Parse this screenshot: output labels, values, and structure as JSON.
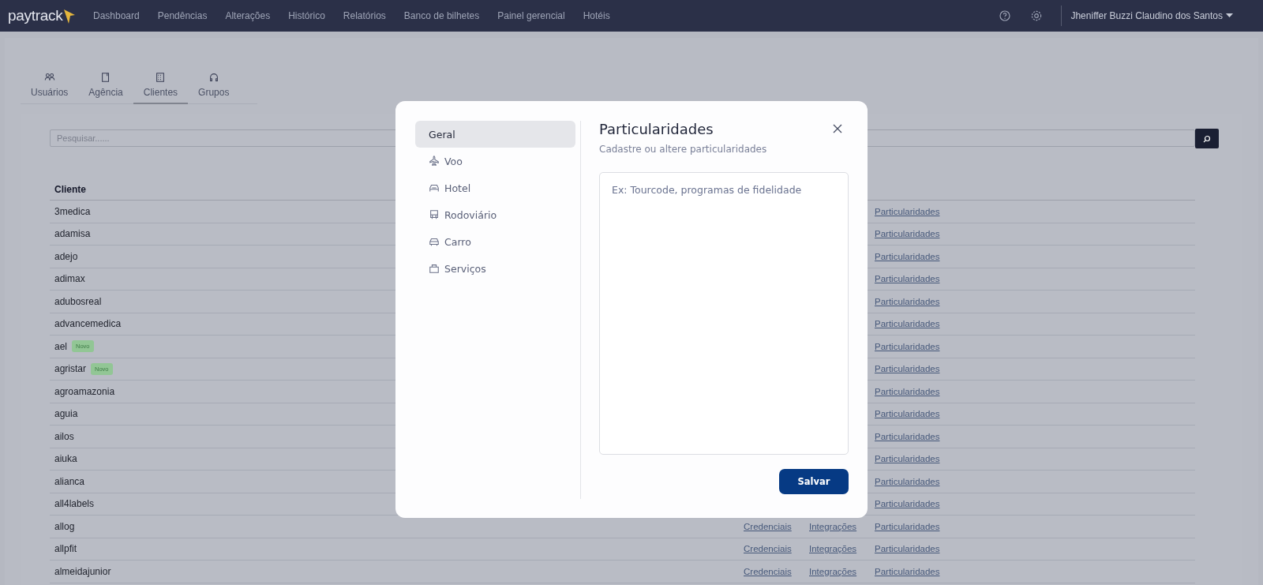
{
  "navbar": {
    "logo": "paytrack",
    "items": [
      "Dashboard",
      "Pendências",
      "Alterações",
      "Histórico",
      "Relatórios",
      "Banco de bilhetes",
      "Painel gerencial",
      "Hotéis"
    ],
    "user": "Jheniffer Buzzi Claudino dos Santos"
  },
  "tabs": [
    {
      "label": "Usuários",
      "selected": false
    },
    {
      "label": "Agência",
      "selected": false
    },
    {
      "label": "Clientes",
      "selected": true
    },
    {
      "label": "Grupos",
      "selected": false
    }
  ],
  "search": {
    "placeholder": "Pesquisar......"
  },
  "table": {
    "columns": [
      "Cliente"
    ],
    "rows": [
      {
        "name": "3medica",
        "particulars": "Particularidades"
      },
      {
        "name": "adamisa",
        "particulars": "Particularidades"
      },
      {
        "name": "adejo",
        "particulars": "Particularidades"
      },
      {
        "name": "adimax",
        "particulars": "Particularidades"
      },
      {
        "name": "adubosreal",
        "particulars": "Particularidades"
      },
      {
        "name": "advancemedica",
        "particulars": "Particularidades"
      },
      {
        "name": "ael",
        "badge": "Novo",
        "particulars": "Particularidades"
      },
      {
        "name": "agristar",
        "badge": "Novo",
        "particulars": "Particularidades"
      },
      {
        "name": "agroamazonia",
        "particulars": "Particularidades"
      },
      {
        "name": "aguia",
        "particulars": "Particularidades"
      },
      {
        "name": "ailos",
        "particulars": "Particularidades"
      },
      {
        "name": "aiuka",
        "particulars": "Particularidades"
      },
      {
        "name": "alianca",
        "particulars": "Particularidades"
      },
      {
        "name": "all4labels",
        "particulars": "Particularidades"
      },
      {
        "name": "allog",
        "credentials": "Credenciais",
        "integrations": "Integrações",
        "particulars": "Particularidades"
      },
      {
        "name": "allpfit",
        "credentials": "Credenciais",
        "integrations": "Integrações",
        "particulars": "Particularidades"
      },
      {
        "name": "almeidajunior",
        "credentials": "Credenciais",
        "integrations": "Integrações",
        "particulars": "Particularidades"
      }
    ]
  },
  "modal": {
    "menu": [
      {
        "label": "Geral",
        "selected": true
      },
      {
        "label": "Voo",
        "selected": false
      },
      {
        "label": "Hotel",
        "selected": false
      },
      {
        "label": "Rodoviário",
        "selected": false
      },
      {
        "label": "Carro",
        "selected": false
      },
      {
        "label": "Serviços",
        "selected": false
      }
    ],
    "title": "Particularidades",
    "subtitle": "Cadastre ou altere particularidades",
    "textarea": {
      "placeholder": "Ex: Tourcode, programas de fidelidade"
    },
    "button": "Salvar"
  }
}
